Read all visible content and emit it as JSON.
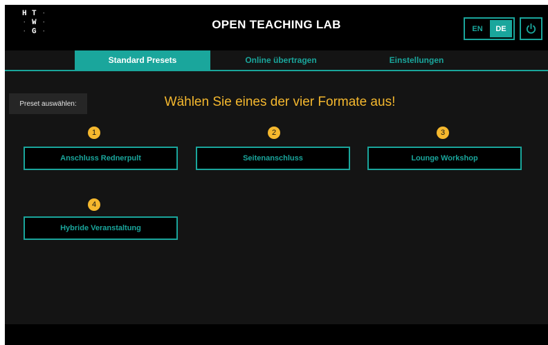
{
  "header": {
    "logo_letters": [
      "H",
      "T",
      "W",
      "G"
    ],
    "title": "OPEN TEACHING LAB",
    "languages": [
      {
        "label": "EN",
        "active": false
      },
      {
        "label": "DE",
        "active": true
      }
    ],
    "power_icon": "power-icon"
  },
  "tabs": [
    {
      "label": "Standard Presets",
      "active": true
    },
    {
      "label": "Online übertragen",
      "active": false
    },
    {
      "label": "Einstellungen",
      "active": false
    }
  ],
  "main": {
    "preset_label": "Preset auswählen:",
    "headline": "Wählen Sie eines der vier Formate aus!",
    "presets": [
      {
        "number": "1",
        "label": "Anschluss Rednerpult"
      },
      {
        "number": "2",
        "label": "Seitenanschluss"
      },
      {
        "number": "3",
        "label": "Lounge Workshop"
      },
      {
        "number": "4",
        "label": "Hybride Veranstaltung"
      }
    ]
  },
  "colors": {
    "accent": "#1aa69c",
    "highlight": "#f5b82e",
    "background": "#141414",
    "header_bg": "#000000"
  }
}
